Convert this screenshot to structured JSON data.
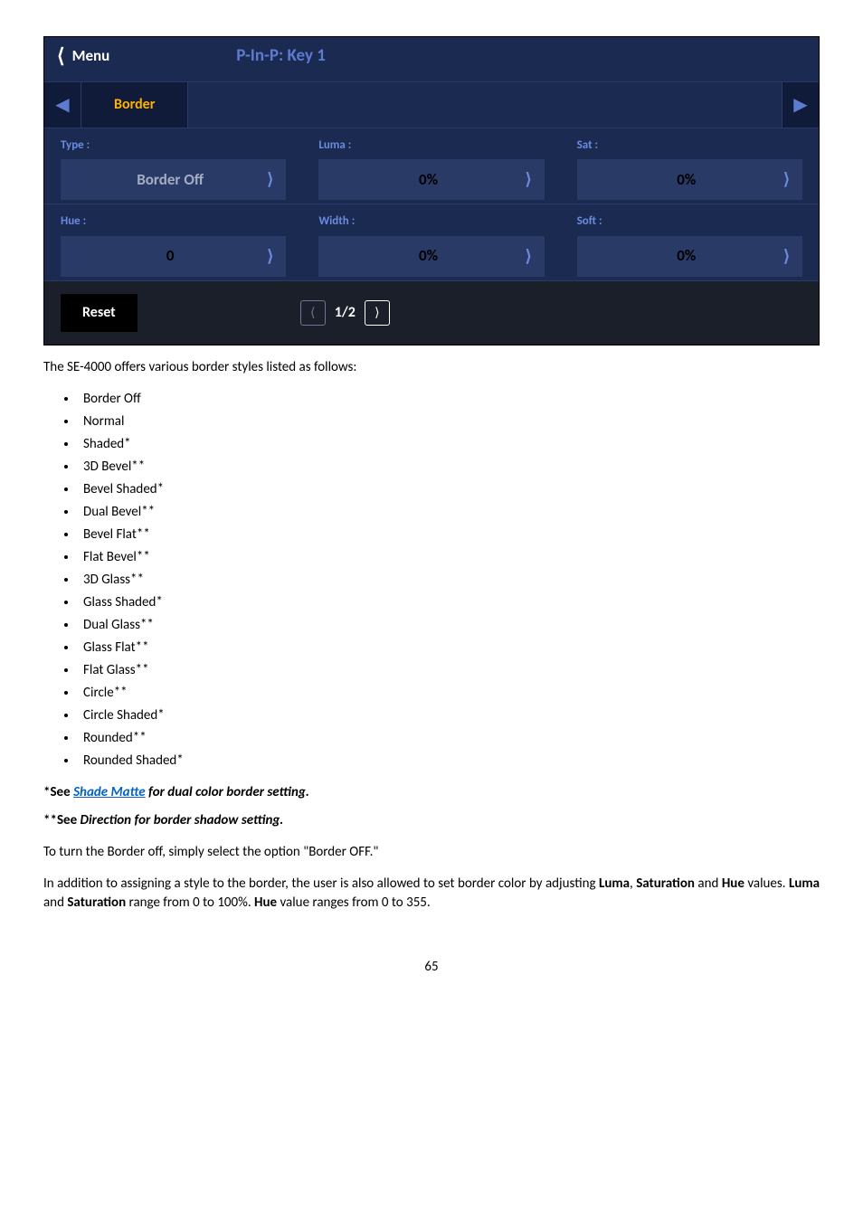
{
  "panel": {
    "back": "Menu",
    "title": "P-In-P: Key 1",
    "tab": "Border",
    "fields": {
      "type": {
        "label": "Type :",
        "value": "Border Off"
      },
      "luma": {
        "label": "Luma :",
        "value": "0%"
      },
      "sat": {
        "label": "Sat :",
        "value": "0%"
      },
      "hue": {
        "label": "Hue :",
        "value": "0"
      },
      "width": {
        "label": "Width :",
        "value": "0%"
      },
      "soft": {
        "label": "Soft :",
        "value": "0%"
      }
    },
    "reset": "Reset",
    "page": "1/2"
  },
  "intro": "The SE-4000 offers various border styles listed as follows:",
  "styles": [
    "Border Off",
    "Normal",
    "Shaded*",
    "3D Bevel**",
    "Bevel Shaded*",
    "Dual Bevel**",
    "Bevel Flat**",
    "Flat Bevel**",
    "3D Glass**",
    "Glass Shaded*",
    "Dual Glass**",
    "Glass Flat**",
    "Flat Glass**",
    "Circle**",
    "Circle Shaded*",
    "Rounded**",
    "Rounded Shaded*"
  ],
  "note1_pre": "*See ",
  "note1_link": "Shade Matte",
  "note1_post": " for dual color border setting",
  "note2": "**See Direction for border shadow setting.",
  "p_off": "To turn the Border off, simply select the option \"Border OFF.\"",
  "p_color_1": "In addition to assigning a style to the border, the user is also allowed to set border color by adjusting ",
  "p_color_luma": "Luma",
  "p_color_2": ", ",
  "p_color_sat": "Saturation",
  "p_color_3": " and ",
  "p_color_hue": "Hue",
  "p_color_4": " values. ",
  "p_color_5": " and ",
  "p_color_6": " range from 0 to 100%. ",
  "p_color_7": " value ranges from 0 to 355.",
  "pagenum": "65"
}
